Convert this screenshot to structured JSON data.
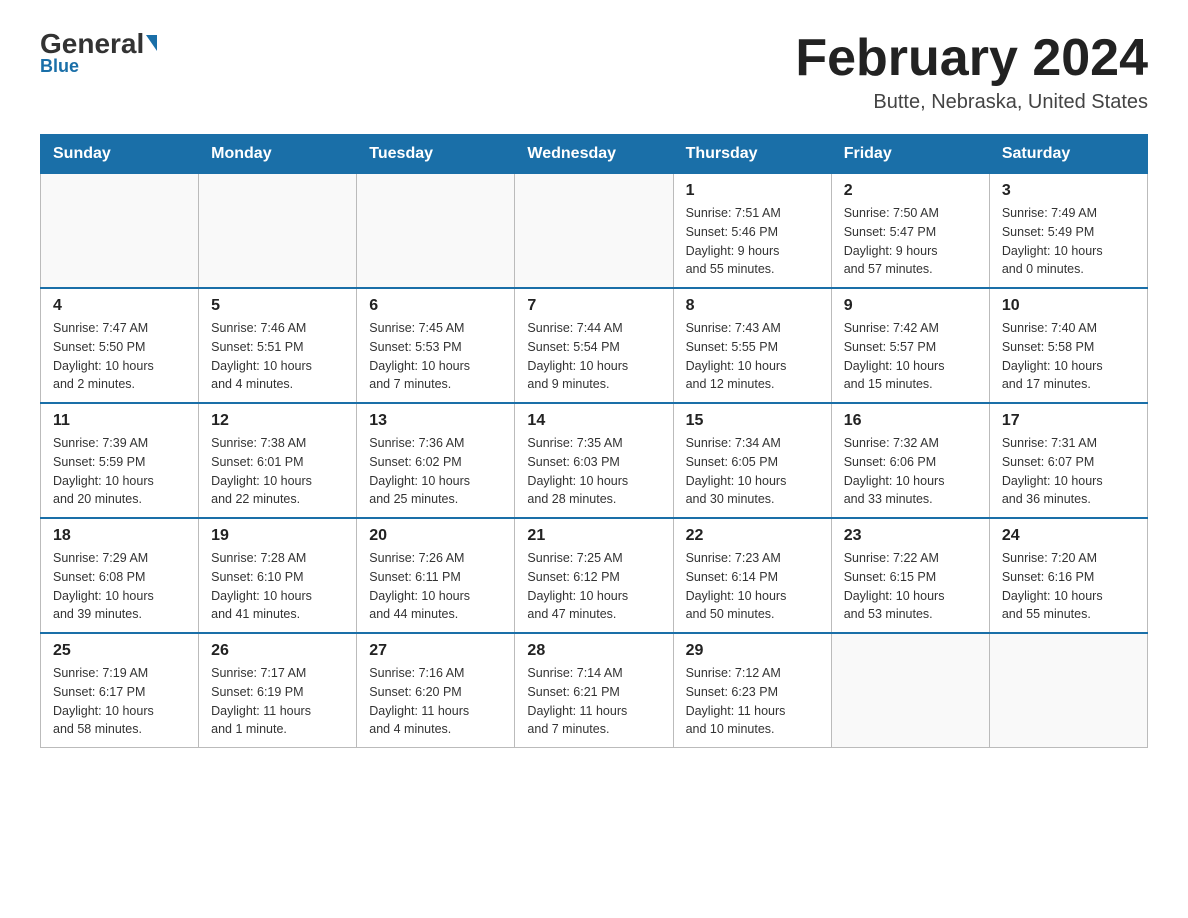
{
  "header": {
    "logo_general": "General",
    "logo_blue": "Blue",
    "month_title": "February 2024",
    "location": "Butte, Nebraska, United States"
  },
  "weekdays": [
    "Sunday",
    "Monday",
    "Tuesday",
    "Wednesday",
    "Thursday",
    "Friday",
    "Saturday"
  ],
  "weeks": [
    [
      {
        "day": "",
        "info": ""
      },
      {
        "day": "",
        "info": ""
      },
      {
        "day": "",
        "info": ""
      },
      {
        "day": "",
        "info": ""
      },
      {
        "day": "1",
        "info": "Sunrise: 7:51 AM\nSunset: 5:46 PM\nDaylight: 9 hours\nand 55 minutes."
      },
      {
        "day": "2",
        "info": "Sunrise: 7:50 AM\nSunset: 5:47 PM\nDaylight: 9 hours\nand 57 minutes."
      },
      {
        "day": "3",
        "info": "Sunrise: 7:49 AM\nSunset: 5:49 PM\nDaylight: 10 hours\nand 0 minutes."
      }
    ],
    [
      {
        "day": "4",
        "info": "Sunrise: 7:47 AM\nSunset: 5:50 PM\nDaylight: 10 hours\nand 2 minutes."
      },
      {
        "day": "5",
        "info": "Sunrise: 7:46 AM\nSunset: 5:51 PM\nDaylight: 10 hours\nand 4 minutes."
      },
      {
        "day": "6",
        "info": "Sunrise: 7:45 AM\nSunset: 5:53 PM\nDaylight: 10 hours\nand 7 minutes."
      },
      {
        "day": "7",
        "info": "Sunrise: 7:44 AM\nSunset: 5:54 PM\nDaylight: 10 hours\nand 9 minutes."
      },
      {
        "day": "8",
        "info": "Sunrise: 7:43 AM\nSunset: 5:55 PM\nDaylight: 10 hours\nand 12 minutes."
      },
      {
        "day": "9",
        "info": "Sunrise: 7:42 AM\nSunset: 5:57 PM\nDaylight: 10 hours\nand 15 minutes."
      },
      {
        "day": "10",
        "info": "Sunrise: 7:40 AM\nSunset: 5:58 PM\nDaylight: 10 hours\nand 17 minutes."
      }
    ],
    [
      {
        "day": "11",
        "info": "Sunrise: 7:39 AM\nSunset: 5:59 PM\nDaylight: 10 hours\nand 20 minutes."
      },
      {
        "day": "12",
        "info": "Sunrise: 7:38 AM\nSunset: 6:01 PM\nDaylight: 10 hours\nand 22 minutes."
      },
      {
        "day": "13",
        "info": "Sunrise: 7:36 AM\nSunset: 6:02 PM\nDaylight: 10 hours\nand 25 minutes."
      },
      {
        "day": "14",
        "info": "Sunrise: 7:35 AM\nSunset: 6:03 PM\nDaylight: 10 hours\nand 28 minutes."
      },
      {
        "day": "15",
        "info": "Sunrise: 7:34 AM\nSunset: 6:05 PM\nDaylight: 10 hours\nand 30 minutes."
      },
      {
        "day": "16",
        "info": "Sunrise: 7:32 AM\nSunset: 6:06 PM\nDaylight: 10 hours\nand 33 minutes."
      },
      {
        "day": "17",
        "info": "Sunrise: 7:31 AM\nSunset: 6:07 PM\nDaylight: 10 hours\nand 36 minutes."
      }
    ],
    [
      {
        "day": "18",
        "info": "Sunrise: 7:29 AM\nSunset: 6:08 PM\nDaylight: 10 hours\nand 39 minutes."
      },
      {
        "day": "19",
        "info": "Sunrise: 7:28 AM\nSunset: 6:10 PM\nDaylight: 10 hours\nand 41 minutes."
      },
      {
        "day": "20",
        "info": "Sunrise: 7:26 AM\nSunset: 6:11 PM\nDaylight: 10 hours\nand 44 minutes."
      },
      {
        "day": "21",
        "info": "Sunrise: 7:25 AM\nSunset: 6:12 PM\nDaylight: 10 hours\nand 47 minutes."
      },
      {
        "day": "22",
        "info": "Sunrise: 7:23 AM\nSunset: 6:14 PM\nDaylight: 10 hours\nand 50 minutes."
      },
      {
        "day": "23",
        "info": "Sunrise: 7:22 AM\nSunset: 6:15 PM\nDaylight: 10 hours\nand 53 minutes."
      },
      {
        "day": "24",
        "info": "Sunrise: 7:20 AM\nSunset: 6:16 PM\nDaylight: 10 hours\nand 55 minutes."
      }
    ],
    [
      {
        "day": "25",
        "info": "Sunrise: 7:19 AM\nSunset: 6:17 PM\nDaylight: 10 hours\nand 58 minutes."
      },
      {
        "day": "26",
        "info": "Sunrise: 7:17 AM\nSunset: 6:19 PM\nDaylight: 11 hours\nand 1 minute."
      },
      {
        "day": "27",
        "info": "Sunrise: 7:16 AM\nSunset: 6:20 PM\nDaylight: 11 hours\nand 4 minutes."
      },
      {
        "day": "28",
        "info": "Sunrise: 7:14 AM\nSunset: 6:21 PM\nDaylight: 11 hours\nand 7 minutes."
      },
      {
        "day": "29",
        "info": "Sunrise: 7:12 AM\nSunset: 6:23 PM\nDaylight: 11 hours\nand 10 minutes."
      },
      {
        "day": "",
        "info": ""
      },
      {
        "day": "",
        "info": ""
      }
    ]
  ]
}
